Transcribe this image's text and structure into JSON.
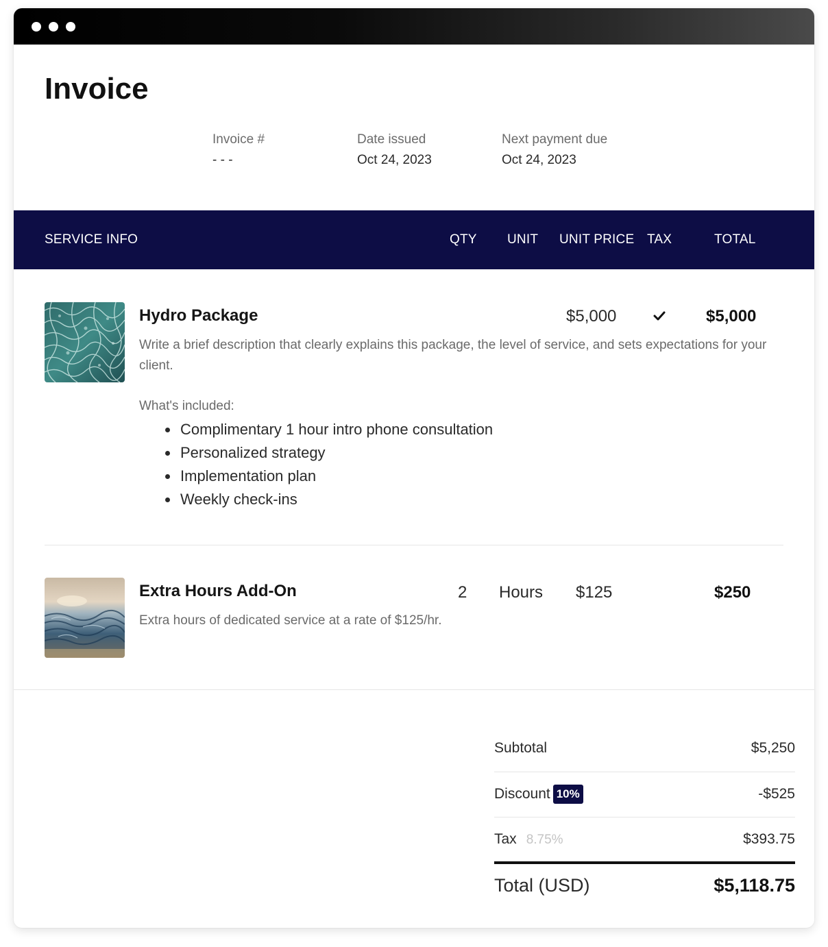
{
  "invoice": {
    "title": "Invoice",
    "meta": [
      {
        "label": "Invoice #",
        "value": "- - -"
      },
      {
        "label": "Date issued",
        "value": "Oct 24, 2023"
      },
      {
        "label": "Next payment due",
        "value": "Oct 24, 2023"
      }
    ]
  },
  "table": {
    "headers": {
      "service_info": "SERVICE INFO",
      "qty": "QTY",
      "unit": "UNIT",
      "unit_price": "UNIT PRICE",
      "tax": "TAX",
      "total": "TOTAL"
    }
  },
  "items": [
    {
      "name": "Hydro Package",
      "description": "Write a brief description that clearly explains this package, the level of service, and sets expectations for your client.",
      "qty": "",
      "unit": "",
      "unit_price": "$5,000",
      "taxed": true,
      "tax_icon": "checkmark-icon",
      "total": "$5,000",
      "included_label": "What's included:",
      "included": [
        "Complimentary 1 hour intro phone consultation",
        "Personalized strategy",
        "Implementation plan",
        "Weekly check-ins"
      ],
      "thumbnail": "water-surface-image"
    },
    {
      "name": "Extra Hours Add-On",
      "description": "Extra hours of dedicated service at a rate of $125/hr.",
      "qty": "2",
      "unit": "Hours",
      "unit_price": "$125",
      "taxed": false,
      "total": "$250",
      "thumbnail": "ocean-wave-image"
    }
  ],
  "summary": {
    "subtotal_label": "Subtotal",
    "subtotal_value": "$5,250",
    "discount_label": "Discount",
    "discount_badge": "10%",
    "discount_value": "-$525",
    "tax_label": "Tax",
    "tax_rate": "8.75%",
    "tax_value": "$393.75",
    "total_label": "Total (USD)",
    "total_value": "$5,118.75"
  },
  "colors": {
    "header_bg": "#0d0d45",
    "badge_bg": "#0d0d45",
    "text_primary": "#111111",
    "text_muted": "#6a6a6a"
  }
}
